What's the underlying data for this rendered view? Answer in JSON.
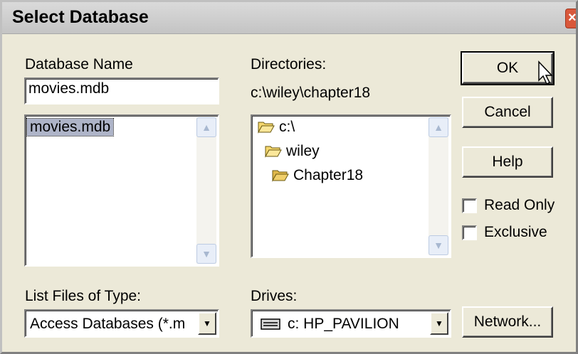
{
  "dialog": {
    "title": "Select Database",
    "close_glyph": "×"
  },
  "database_name": {
    "label": "Database Name",
    "value": "movies.mdb",
    "files": [
      "movies.mdb"
    ]
  },
  "directories": {
    "label": "Directories:",
    "current_path": "c:\\wiley\\chapter18",
    "tree": [
      {
        "label": "c:\\",
        "icon": "open-folder-icon"
      },
      {
        "label": "wiley",
        "icon": "open-folder-icon"
      },
      {
        "label": "Chapter18",
        "icon": "open-folder-icon"
      }
    ]
  },
  "list_type": {
    "label": "List Files of Type:",
    "selected": "Access Databases (*.m"
  },
  "drives": {
    "label": "Drives:",
    "selected": "c: HP_PAVILION",
    "icon": "drive-icon"
  },
  "buttons": {
    "ok": "OK",
    "cancel": "Cancel",
    "help": "Help",
    "network": "Network..."
  },
  "options": {
    "read_only": {
      "label": "Read Only",
      "checked": false
    },
    "exclusive": {
      "label": "Exclusive",
      "checked": false
    }
  },
  "colors": {
    "dialog_bg": "#ece9d8",
    "selection": "#aeb4c8",
    "folder": "#f5d76e"
  }
}
